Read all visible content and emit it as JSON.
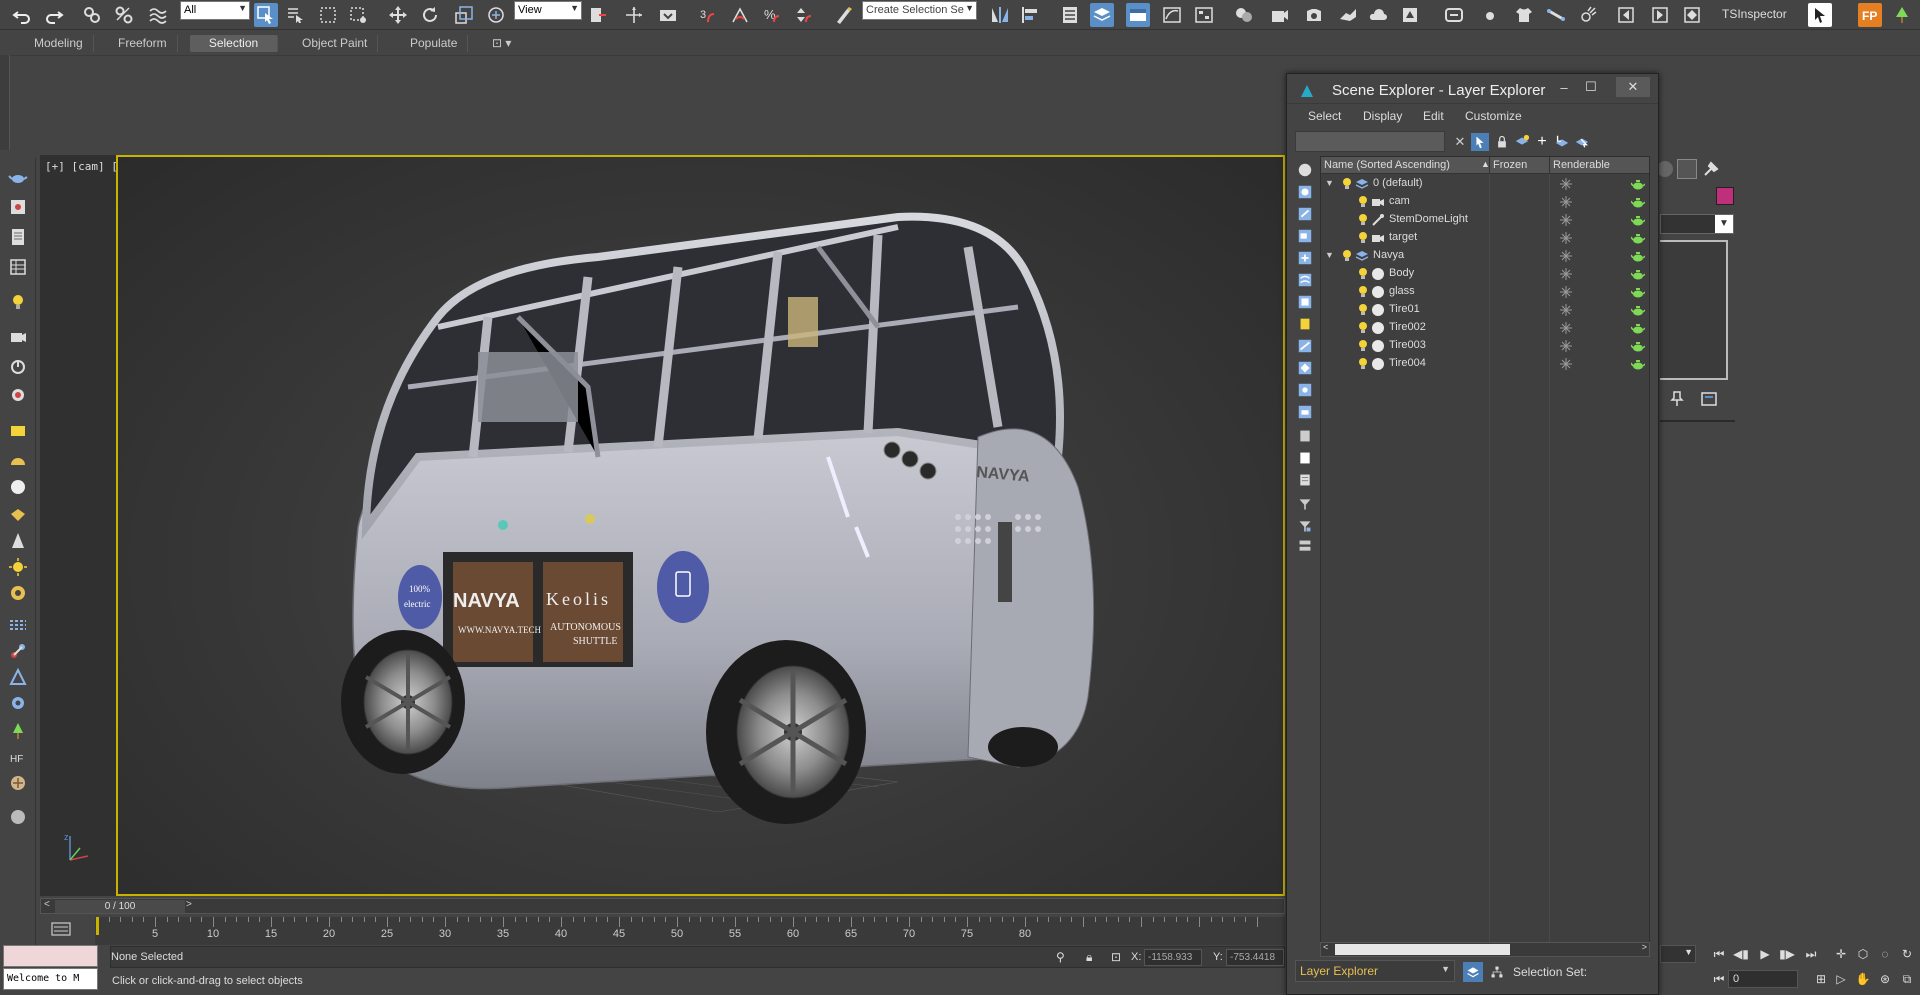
{
  "toolbar": {
    "selection_filter": "All",
    "ref_coord": "View",
    "named_selection_placeholder": "Create Selection Se",
    "ts_inspector": "TSInspector"
  },
  "ribbon": {
    "tabs": [
      {
        "label": "Modeling",
        "active": false
      },
      {
        "label": "Freeform",
        "active": false
      },
      {
        "label": "Selection",
        "active": true
      },
      {
        "label": "Object Paint",
        "active": false
      },
      {
        "label": "Populate",
        "active": false
      }
    ]
  },
  "viewport": {
    "label": "[+] [cam] [Shaded]",
    "vehicle": {
      "brand_logo": "NAVYA",
      "partner_logo": "Keolis",
      "badge_line1": "100%",
      "badge_line2": "electric",
      "url": "WWW.NAVYA.TECH",
      "shuttle_line1": "AUTONOMOUS",
      "shuttle_line2": "SHUTTLE",
      "front_badge": "NAVYA"
    }
  },
  "timeline": {
    "frame_display": "0 / 100",
    "ticks": [
      "5",
      "10",
      "15",
      "20",
      "25",
      "30",
      "35",
      "40",
      "45",
      "50",
      "55",
      "60",
      "65",
      "70",
      "75",
      "80"
    ],
    "frame_value": "0"
  },
  "status": {
    "selection": "None Selected",
    "prompt": "Click or click-and-drag to select objects",
    "x_label": "X:",
    "x_value": "-1158.933",
    "y_label": "Y:",
    "y_value": "-753.4418",
    "maxscript_welcome": "Welcome to M"
  },
  "scene_explorer": {
    "title": "Scene Explorer - Layer Explorer",
    "menus": [
      "Select",
      "Display",
      "Edit",
      "Customize"
    ],
    "columns": {
      "name": "Name (Sorted Ascending)",
      "frozen": "Frozen",
      "renderable": "Renderable"
    },
    "rows": [
      {
        "name": "0 (default)",
        "type": "layer",
        "level": 0,
        "expanded": true
      },
      {
        "name": "cam",
        "type": "camera",
        "level": 1
      },
      {
        "name": "StemDomeLight",
        "type": "light",
        "level": 1
      },
      {
        "name": "target",
        "type": "camera",
        "level": 1
      },
      {
        "name": "Navya",
        "type": "layer",
        "level": 0,
        "expanded": true
      },
      {
        "name": "Body",
        "type": "geometry",
        "level": 1
      },
      {
        "name": "glass",
        "type": "geometry",
        "level": 1
      },
      {
        "name": "Tire01",
        "type": "geometry",
        "level": 1
      },
      {
        "name": "Tire002",
        "type": "geometry",
        "level": 1
      },
      {
        "name": "Tire003",
        "type": "geometry",
        "level": 1
      },
      {
        "name": "Tire004",
        "type": "geometry",
        "level": 1
      }
    ],
    "footer": {
      "explorer_name": "Layer Explorer",
      "selection_set_label": "Selection Set:"
    }
  },
  "right_panel": {
    "object_color": "#c0307a"
  },
  "colors": {
    "ui_bg": "#444444",
    "viewport_border": "#c8b400",
    "active_blue": "#5a8fc8",
    "layer_label": "#e8c050",
    "bulb": "#f3d23a",
    "teapot": "#7ed957"
  }
}
